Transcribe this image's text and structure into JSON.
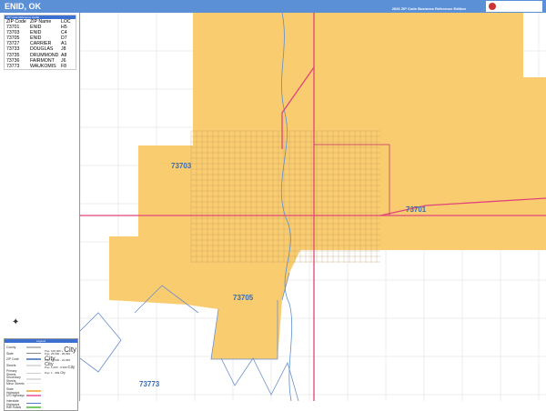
{
  "header": {
    "title": "ENID, OK",
    "edition": "2026 ZIP Code Business Reference Edition",
    "logo": "MarketMAPS"
  },
  "zip_table": {
    "caption": "ZIP Code Reference Guide",
    "columns": [
      "ZIP Code",
      "ZIP Name",
      "LOC"
    ],
    "rows": [
      [
        "73701",
        "ENID",
        "H5"
      ],
      [
        "73703",
        "ENID",
        "C4"
      ],
      [
        "73705",
        "ENID",
        "D7"
      ],
      [
        "73727",
        "CARRIER",
        "A1"
      ],
      [
        "73733",
        "DOUGLAS",
        "J8"
      ],
      [
        "73735",
        "DRUMMOND",
        "A8"
      ],
      [
        "73736",
        "FAIRMONT",
        "J6"
      ],
      [
        "73773",
        "WAUKOMIS",
        "F8"
      ]
    ]
  },
  "legend": {
    "title": "Legend",
    "items": [
      {
        "label": "County",
        "color": "#bbbbbb"
      },
      {
        "label": "State",
        "color": "#888888"
      },
      {
        "label": "ZIP Code",
        "color": "#6b8fc9"
      },
      {
        "label": "Streets",
        "color": "#dddddd"
      },
      {
        "label": "Primary Streets",
        "color": "#cccccc"
      },
      {
        "label": "Secondary Streets",
        "color": "#dddddd"
      },
      {
        "label": "Minor Streets",
        "color": "#eeeeee"
      },
      {
        "label": "State Highways",
        "color": "#f4b860"
      },
      {
        "label": "US Highways",
        "color": "#f07ab0"
      },
      {
        "label": "Interstate Highways",
        "color": "#4a7fd6"
      },
      {
        "label": "Rail Roads",
        "color": "#7ac86a"
      }
    ],
    "city_labels": [
      {
        "range": "Pop: 100,000 +",
        "label": "City"
      },
      {
        "range": "Pop: 25,000 - 99,999",
        "label": "City"
      },
      {
        "range": "Pop: 10,000 - 24,999",
        "label": "City"
      },
      {
        "range": "Pop: 1,000 - 9,999",
        "label": "City"
      },
      {
        "range": "Pop: 1 - 999",
        "label": "City"
      }
    ]
  },
  "map": {
    "zip_labels": [
      "73703",
      "73701",
      "73705",
      "73773"
    ],
    "zip_fill": "#f9cc70",
    "highway_color": "#e0457a",
    "water_color": "#5a8fd0"
  }
}
